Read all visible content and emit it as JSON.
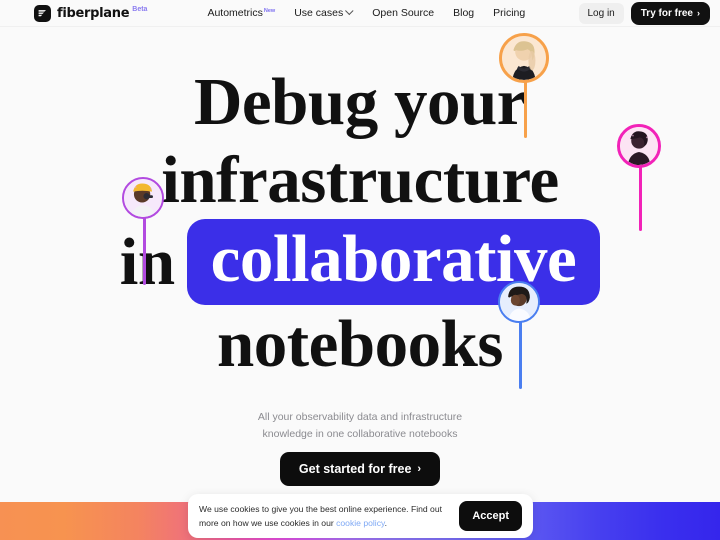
{
  "nav": {
    "brand": {
      "name": "fiberplane",
      "badge": "Beta",
      "logo_icon": "fiberplane-logo-icon"
    },
    "links": [
      {
        "label": "Autometrics",
        "sup": "New",
        "has_chevron": false
      },
      {
        "label": "Use cases",
        "sup": "",
        "has_chevron": true
      },
      {
        "label": "Open Source",
        "sup": "",
        "has_chevron": false
      },
      {
        "label": "Blog",
        "sup": "",
        "has_chevron": false
      },
      {
        "label": "Pricing",
        "sup": "",
        "has_chevron": false
      }
    ],
    "login_label": "Log in",
    "try_label": "Try for free",
    "try_arrow": "›"
  },
  "hero": {
    "line1": "Debug your",
    "line2": "infrastructure",
    "line3_prefix": "in",
    "line3_chip": "collaborative",
    "line4": "notebooks",
    "chip_color": "#3b2fe8",
    "subtitle_line1": "All your observability data and infrastructure",
    "subtitle_line2": "knowledge in one collaborative notebooks",
    "cta_label": "Get started for free",
    "cta_arrow": "›"
  },
  "pins": [
    {
      "name": "avatar-pin-orange",
      "color": "#f7a14a",
      "label": "collaborator avatar orange"
    },
    {
      "name": "avatar-pin-pink",
      "color": "#f222b8",
      "label": "collaborator avatar pink"
    },
    {
      "name": "avatar-pin-purple",
      "color": "#b24ae0",
      "label": "collaborator avatar purple"
    },
    {
      "name": "avatar-pin-blue",
      "color": "#4a7ef0",
      "label": "collaborator avatar blue"
    }
  ],
  "cookie": {
    "text_before": "We use cookies to give you the best online experience. Find out more on how we use cookies in our ",
    "link_label": "cookie policy",
    "text_after": ".",
    "accept_label": "Accept"
  },
  "gradient": {
    "stops": [
      "#f79153",
      "#ef6f7e",
      "#e54cd6",
      "#a96ef0",
      "#5f5bf2",
      "#3526ec"
    ]
  }
}
